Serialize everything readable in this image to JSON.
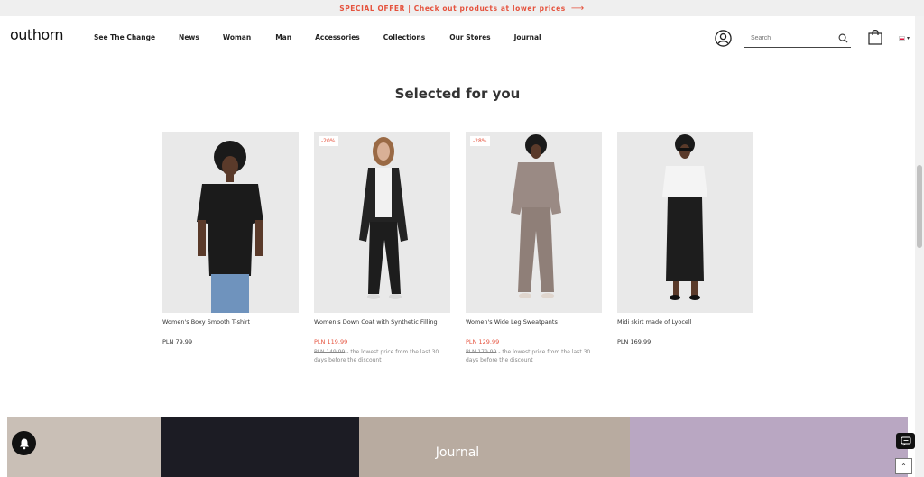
{
  "promo": {
    "text": "SPECIAL OFFER | Check out products at lower prices",
    "arrow": "⟶"
  },
  "header": {
    "logo": "outhorn",
    "nav": [
      "See The Change",
      "News",
      "Woman",
      "Man",
      "Accessories",
      "Collections",
      "Our Stores",
      "Journal"
    ],
    "search_placeholder": "Search",
    "icons": [
      "user-icon",
      "search-icon",
      "bag-icon",
      "flag-pl-icon",
      "chevron-down-icon"
    ]
  },
  "section": {
    "title": "Selected for you"
  },
  "products": [
    {
      "name": "Women's Boxy Smooth T-shirt",
      "price": "PLN 79.99",
      "badge": "",
      "old_price": "",
      "note": "",
      "sale": false
    },
    {
      "name": "Women's Down Coat with Synthetic Filling",
      "price": "PLN 119.99",
      "badge": "-20%",
      "old_price": "PLN 149.99",
      "note": " - the lowest price from the last 30 days before the discount",
      "sale": true
    },
    {
      "name": "Women's Wide Leg Sweatpants",
      "price": "PLN 129.99",
      "badge": "-28%",
      "old_price": "PLN 179.99",
      "note": " - the lowest price from the last 30 days before the discount",
      "sale": true
    },
    {
      "name": "Midi skirt made of Lyocell",
      "price": "PLN 169.99",
      "badge": "",
      "old_price": "",
      "note": "",
      "sale": false
    }
  ],
  "journal": {
    "title": "Journal"
  },
  "widgets": {
    "totop": "⌃"
  },
  "colors": {
    "accent": "#e5523d",
    "text": "#222222",
    "banner_bg": "#efefef"
  }
}
